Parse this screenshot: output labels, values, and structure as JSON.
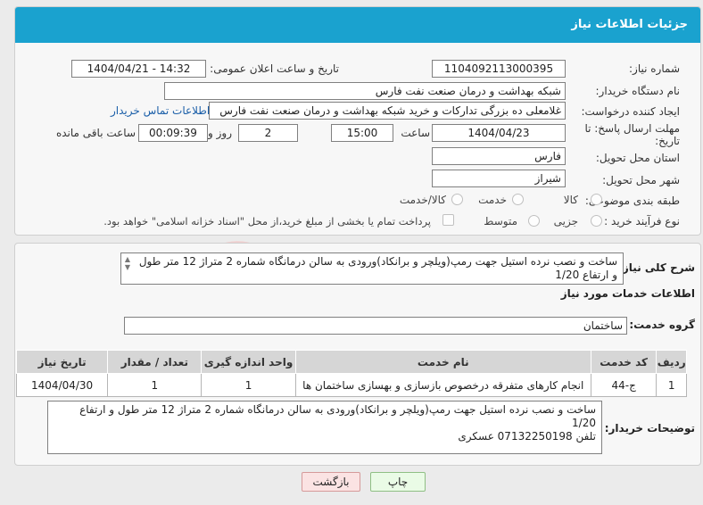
{
  "header": {
    "title": "جزئیات اطلاعات نیاز"
  },
  "form": {
    "need_number_label": "شماره نیاز:",
    "need_number": "1104092113000395",
    "announce_label": "تاریخ و ساعت اعلان عمومی:",
    "announce_value": "1404/04/21 - 14:32",
    "buyer_org_label": "نام دستگاه خریدار:",
    "buyer_org": "شبکه بهداشت و درمان صنعت نفت فارس",
    "requester_label": "ایجاد کننده درخواست:",
    "requester": "غلامعلی ده بزرگی تدارکات و خرید شبکه بهداشت و درمان صنعت نفت فارس",
    "contact_link": "اطلاعات تماس خریدار",
    "deadline_label_1": "مهلت ارسال پاسخ: تا",
    "deadline_label_2": "تاریخ:",
    "deadline_date": "1404/04/23",
    "time_label": "ساعت",
    "deadline_time": "15:00",
    "days_value": "2",
    "days_label": "روز و",
    "remaining_time": "00:09:39",
    "remaining_label": "ساعت باقی مانده",
    "province_label": "استان محل تحویل:",
    "province": "فارس",
    "city_label": "شهر محل تحویل:",
    "city": "شیراز",
    "category_label": "طبقه بندی موضوعی:",
    "category_options": [
      "کالا",
      "خدمت",
      "کالا/خدمت"
    ],
    "purchase_type_label": "نوع فرآیند خرید :",
    "purchase_options": [
      "جزیی",
      "متوسط"
    ],
    "payment_note": "پرداخت تمام یا بخشی از مبلغ خرید،از محل \"اسناد خزانه اسلامی\" خواهد بود."
  },
  "details": {
    "summary_label": "شرح کلی نیاز:",
    "summary": "ساخت و نصب نرده استیل جهت رمپ(ویلچر و برانکاد)ورودی به سالن درمانگاه شماره 2 متراژ 12 متر طول و ارتفاع 1/20",
    "services_heading": "اطلاعات خدمات مورد نیاز",
    "service_group_label": "گروه خدمت:",
    "service_group": "ساختمان",
    "table": {
      "headers": [
        "ردیف",
        "کد خدمت",
        "نام خدمت",
        "واحد اندازه گیری",
        "تعداد / مقدار",
        "تاریخ نیاز"
      ],
      "rows": [
        [
          "1",
          "ج-44",
          "انجام کارهای متفرقه درخصوص بازسازی و بهسازی ساختمان ها",
          "1",
          "1",
          "1404/04/30"
        ]
      ]
    },
    "buyer_notes_label": "توضیحات خریدار:",
    "buyer_notes_line1": "ساخت و نصب نرده استیل جهت رمپ(ویلچر و برانکاد)ورودی به سالن درمانگاه شماره 2 متراژ 12 متر طول و ارتفاع 1/20",
    "buyer_notes_line2": "تلفن 07132250198 عسکری"
  },
  "buttons": {
    "print": "چاپ",
    "back": "بازگشت"
  },
  "watermark_text": "AriaTender.neT",
  "colors": {
    "header": "#1aa2cf",
    "link": "#1a5ea8",
    "watermark": "#f0cfcf"
  }
}
